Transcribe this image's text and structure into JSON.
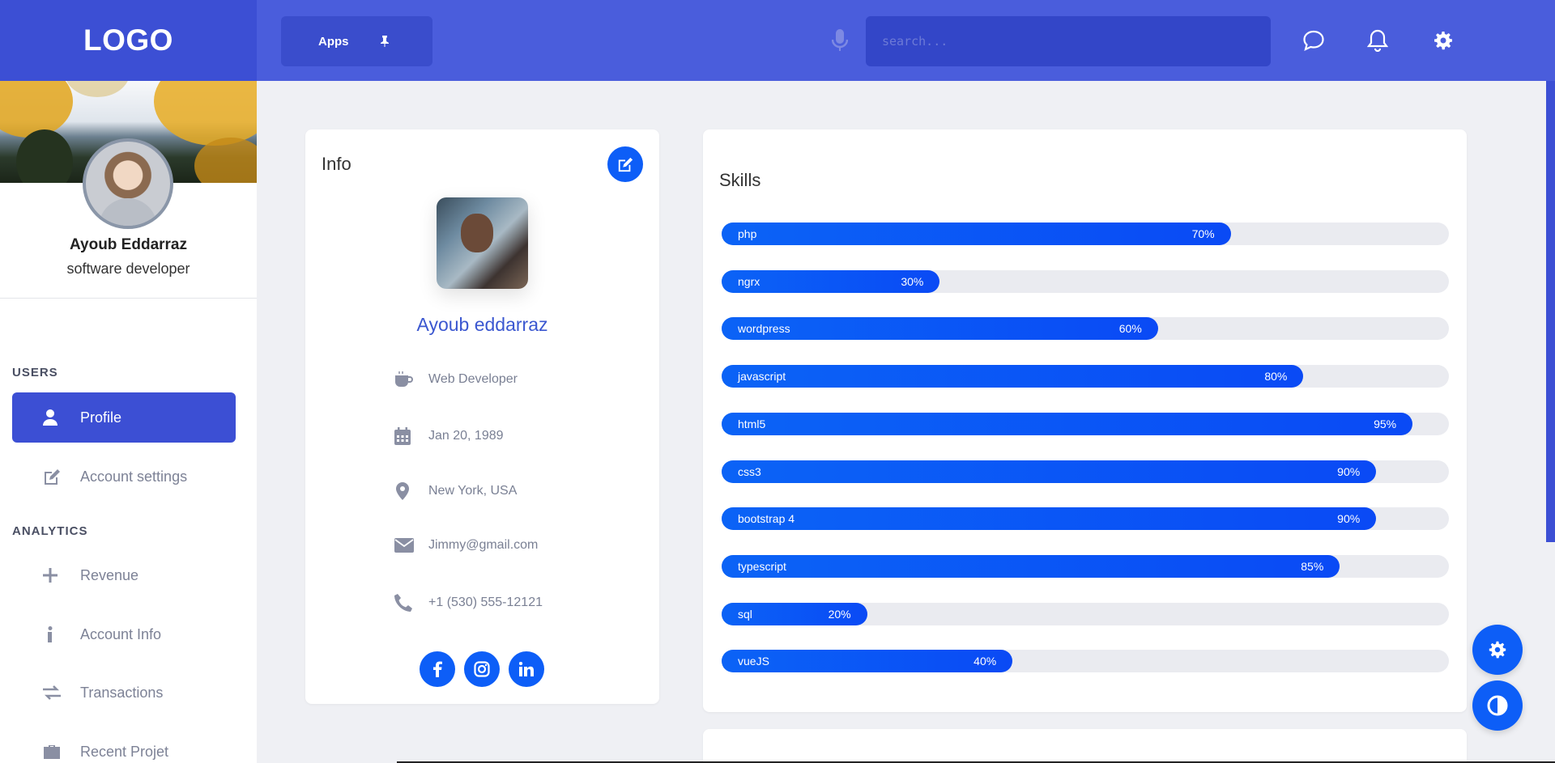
{
  "header": {
    "logo": "LOGO",
    "apps_label": "Apps",
    "search_placeholder": "search...",
    "icons": [
      "microphone-icon",
      "chat-icon",
      "bell-icon",
      "gear-icon",
      "pin-icon"
    ]
  },
  "sidebar": {
    "name": "Ayoub Eddarraz",
    "role": "software developer",
    "sections": [
      {
        "title": "USERS",
        "items": [
          {
            "label": "Profile",
            "icon": "user-icon",
            "active": true
          },
          {
            "label": "Account settings",
            "icon": "edit-icon",
            "active": false
          }
        ]
      },
      {
        "title": "ANALYTICS",
        "items": [
          {
            "label": "Revenue",
            "icon": "plus-icon",
            "active": false
          },
          {
            "label": "Account Info",
            "icon": "info-icon",
            "active": false
          },
          {
            "label": "Transactions",
            "icon": "exchange-icon",
            "active": false
          },
          {
            "label": "Recent Projet",
            "icon": "briefcase-icon",
            "active": false
          }
        ]
      }
    ]
  },
  "info": {
    "title": "Info",
    "name": "Ayoub eddarraz",
    "job": "Web Developer",
    "birthdate": "Jan 20, 1989",
    "location": "New York, USA",
    "email": "Jimmy@gmail.com",
    "phone": "+1 (530) 555-12121",
    "socials": [
      "facebook-icon",
      "instagram-icon",
      "linkedin-icon"
    ]
  },
  "skills": {
    "title": "Skills",
    "items": [
      {
        "name": "php",
        "percent": 70,
        "label": "70%"
      },
      {
        "name": "ngrx",
        "percent": 30,
        "label": "30%"
      },
      {
        "name": "wordpress",
        "percent": 60,
        "label": "60%"
      },
      {
        "name": "javascript",
        "percent": 80,
        "label": "80%"
      },
      {
        "name": "html5",
        "percent": 95,
        "label": "95%"
      },
      {
        "name": "css3",
        "percent": 90,
        "label": "90%"
      },
      {
        "name": "bootstrap 4",
        "percent": 90,
        "label": "90%"
      },
      {
        "name": "typescript",
        "percent": 85,
        "label": "85%"
      },
      {
        "name": "sql",
        "percent": 20,
        "label": "20%"
      },
      {
        "name": "vueJS",
        "percent": 40,
        "label": "40%"
      }
    ]
  },
  "colors": {
    "header": "#4a5ddc",
    "accent": "#0d5ef7",
    "sidebar_active": "#3c4fd4"
  }
}
